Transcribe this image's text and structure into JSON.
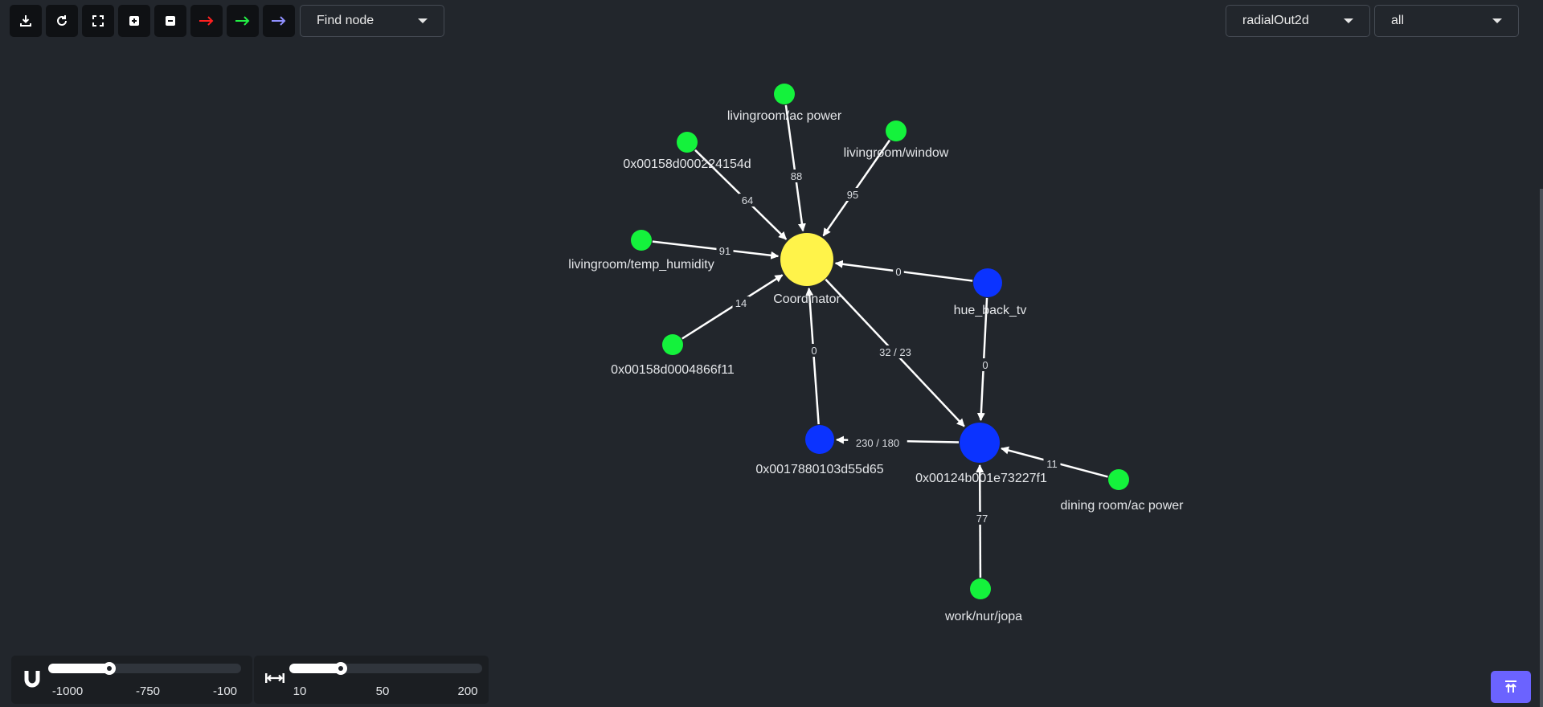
{
  "toolbar": {
    "buttons": [
      {
        "id": "download",
        "icon": "download-icon"
      },
      {
        "id": "refresh",
        "icon": "refresh-icon"
      },
      {
        "id": "fit",
        "icon": "fit-screen-icon"
      },
      {
        "id": "zoom_in",
        "icon": "zoom-in-icon"
      },
      {
        "id": "zoom_out",
        "icon": "zoom-out-icon"
      },
      {
        "id": "red_arrow",
        "icon": "arrow-right-icon",
        "color": "#ff2020"
      },
      {
        "id": "green_arrow",
        "icon": "arrow-right-icon",
        "color": "#22ee44"
      },
      {
        "id": "purple_arrow",
        "icon": "arrow-right-icon",
        "color": "#9090ff"
      }
    ],
    "find_node_label": "Find node"
  },
  "layout_select": {
    "value": "radialOut2d"
  },
  "filter_select": {
    "value": "all"
  },
  "colors": {
    "coordinator": "#fff34a",
    "router": "#0b33ff",
    "end_device": "#14f23c",
    "edge": "#ffffff",
    "background": "#22262c",
    "fab": "#6b63ff"
  },
  "graph": {
    "nodes": [
      {
        "id": "coord",
        "label": "Coordinator",
        "type": "coordinator"
      },
      {
        "id": "ac_power",
        "label": "livingroom/ac power",
        "type": "end_device"
      },
      {
        "id": "dev_154d",
        "label": "0x00158d000224154d",
        "type": "end_device"
      },
      {
        "id": "window",
        "label": "livingroom/window",
        "type": "end_device"
      },
      {
        "id": "temp",
        "label": "livingroom/temp_humidity",
        "type": "end_device"
      },
      {
        "id": "dev_6f11",
        "label": "0x00158d0004866f11",
        "type": "end_device"
      },
      {
        "id": "hue",
        "label": "hue_back_tv",
        "type": "router"
      },
      {
        "id": "dev_5d65",
        "label": "0x0017880103d55d65",
        "type": "router"
      },
      {
        "id": "dev_27f1",
        "label": "0x00124b001e73227f1",
        "type": "router"
      },
      {
        "id": "dining",
        "label": "dining room/ac power",
        "type": "end_device"
      },
      {
        "id": "work",
        "label": "work/nur/jopa",
        "type": "end_device"
      }
    ],
    "edges": [
      {
        "from": "ac_power",
        "to": "coord",
        "label": "88"
      },
      {
        "from": "dev_154d",
        "to": "coord",
        "label": "64"
      },
      {
        "from": "window",
        "to": "coord",
        "label": "95"
      },
      {
        "from": "temp",
        "to": "coord",
        "label": "91"
      },
      {
        "from": "dev_6f11",
        "to": "coord",
        "label": "14"
      },
      {
        "from": "hue",
        "to": "coord",
        "label": "0"
      },
      {
        "from": "dev_5d65",
        "to": "coord",
        "label": "0"
      },
      {
        "from": "coord",
        "to": "dev_27f1",
        "label": "32 / 23"
      },
      {
        "from": "hue",
        "to": "dev_27f1",
        "label": "0"
      },
      {
        "from": "dev_27f1",
        "to": "dev_5d65",
        "label": "230 / 180"
      },
      {
        "from": "dining",
        "to": "dev_27f1",
        "label": "11"
      },
      {
        "from": "work",
        "to": "dev_27f1",
        "label": "77"
      }
    ]
  },
  "sliders": {
    "link_distance": {
      "icon": "magnet-icon",
      "ticks": [
        "-1000",
        "-750",
        "-100"
      ],
      "value_fraction": 0.3
    },
    "node_spacing": {
      "icon": "horizontal-resize-icon",
      "ticks": [
        "10",
        "50",
        "200"
      ],
      "value_fraction": 0.25
    }
  },
  "fab": {
    "icon": "scroll-to-top-icon"
  }
}
